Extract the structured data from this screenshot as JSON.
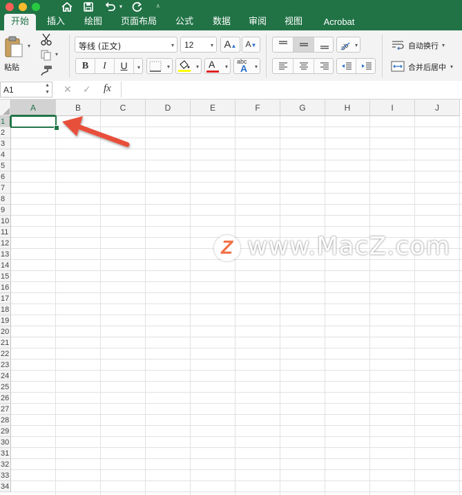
{
  "window": {
    "traffic_lights": [
      "#fe5f57",
      "#febc2e",
      "#28c840"
    ],
    "quick_access": [
      "home-icon",
      "save-icon",
      "undo-icon",
      "redo-icon",
      "customize-icon"
    ]
  },
  "tabs": [
    {
      "label": "开始",
      "active": true
    },
    {
      "label": "插入"
    },
    {
      "label": "绘图"
    },
    {
      "label": "页面布局"
    },
    {
      "label": "公式"
    },
    {
      "label": "数据"
    },
    {
      "label": "审阅"
    },
    {
      "label": "视图"
    },
    {
      "label": "Acrobat"
    }
  ],
  "ribbon": {
    "paste_label": "粘贴",
    "font_name": "等线 (正文)",
    "font_size": "12",
    "bold": "B",
    "italic": "I",
    "underline": "U",
    "grow_font": "A",
    "shrink_font": "A",
    "font_color_letter": "A",
    "text_effects_label": "abc",
    "text_effects_letter": "A",
    "wrap_text": "自动换行",
    "merge_center": "合并后居中",
    "fill_color": "#ffff00",
    "font_color": "#e02020"
  },
  "formula_bar": {
    "name_box": "A1",
    "cancel": "✕",
    "enter": "✓",
    "fx": "fx",
    "content": ""
  },
  "sheet": {
    "columns": [
      "A",
      "B",
      "C",
      "D",
      "E",
      "F",
      "G",
      "H",
      "I",
      "J"
    ],
    "rows": [
      "1",
      "2",
      "3",
      "4",
      "5",
      "6",
      "7",
      "8",
      "9",
      "10",
      "11",
      "12",
      "13",
      "14",
      "15",
      "16",
      "17",
      "18",
      "19",
      "20",
      "21",
      "22",
      "23",
      "24",
      "25",
      "26",
      "27",
      "28",
      "29",
      "30",
      "31",
      "32",
      "33",
      "34"
    ],
    "selected_cell": "A1",
    "selection_color": "#217346"
  },
  "annotation": {
    "arrow_color": "#e8503a"
  },
  "watermark": {
    "text": "www.MacZ.com",
    "logo_letter": "Z",
    "logo_color": "#f05a28"
  }
}
